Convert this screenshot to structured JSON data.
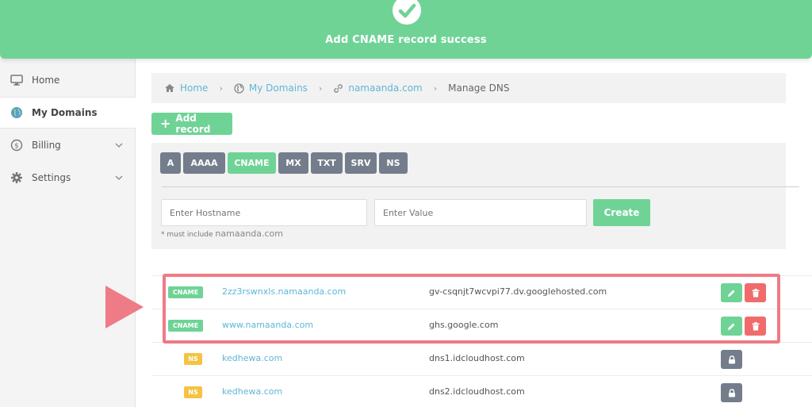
{
  "toast": {
    "message": "Add CNAME record success",
    "icon": "check-icon"
  },
  "sidebar": {
    "items": [
      {
        "label": "Home",
        "icon": "monitor-icon",
        "active": false
      },
      {
        "label": "My Domains",
        "icon": "globe-icon",
        "active": true
      },
      {
        "label": "Billing",
        "icon": "dollar-icon",
        "active": false,
        "expandable": true
      },
      {
        "label": "Settings",
        "icon": "gear-icon",
        "active": false,
        "expandable": true
      }
    ]
  },
  "breadcrumb": {
    "items": [
      "Home",
      "My Domains",
      "namaanda.com"
    ],
    "current": "Manage DNS"
  },
  "add_record_label": "Add record",
  "record_types": [
    "A",
    "AAAA",
    "CNAME",
    "MX",
    "TXT",
    "SRV",
    "NS"
  ],
  "selected_type": "CNAME",
  "form": {
    "hostname_placeholder": "Enter Hostname",
    "value_placeholder": "Enter Value",
    "create_label": "Create",
    "hint_prefix": "* must include",
    "hint_domain": "namaanda.com"
  },
  "records": [
    {
      "type": "CNAME",
      "host": "2zz3rswnxls.namaanda.com",
      "value": "gv-csqnjt7wcvpi77.dv.googlehosted.com",
      "editable": true
    },
    {
      "type": "CNAME",
      "host": "www.namaanda.com",
      "value": "ghs.google.com",
      "editable": true
    },
    {
      "type": "NS",
      "host": "kedhewa.com",
      "value": "dns1.idcloudhost.com",
      "editable": false
    },
    {
      "type": "NS",
      "host": "kedhewa.com",
      "value": "dns2.idcloudhost.com",
      "editable": false
    }
  ],
  "colors": {
    "accent_green": "#6fd396",
    "highlight": "#ee7b86",
    "link": "#5fb6d6",
    "type_gray": "#737d8c",
    "ns_badge": "#f4c343",
    "delete_red": "#f06b6b"
  }
}
